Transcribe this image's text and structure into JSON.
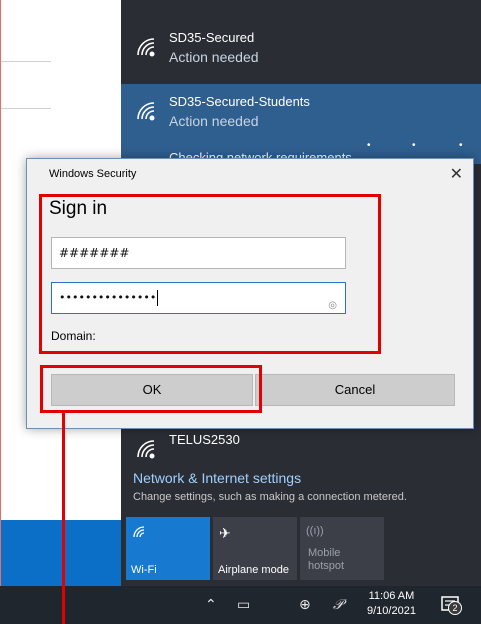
{
  "networks": [
    {
      "name": "SD35-Secured",
      "status": "Action needed"
    },
    {
      "name": "SD35-Secured-Students",
      "status": "Action needed",
      "progress_text": "Checking network requirements"
    },
    {
      "name": "TELUS2530",
      "status": ""
    }
  ],
  "settings": {
    "title": "Network & Internet settings",
    "subtitle": "Change settings, such as making a connection metered."
  },
  "quick_actions": [
    {
      "label": "Wi-Fi",
      "icon": "wifi-icon",
      "active": true
    },
    {
      "label": "Airplane mode",
      "icon": "airplane-icon",
      "active": false
    },
    {
      "label": "Mobile hotspot",
      "line1": "Mobile",
      "line2": "hotspot",
      "icon": "hotspot-icon",
      "active": false,
      "disabled": true
    }
  ],
  "dialog": {
    "title": "Windows Security",
    "heading": "Sign in",
    "username_value": "#######",
    "password_value": "•••••••••••••••",
    "domain_label": "Domain:",
    "ok_label": "OK",
    "cancel_label": "Cancel"
  },
  "taskbar": {
    "time": "11:06 AM",
    "date": "9/10/2021",
    "notification_count": "2"
  },
  "colors": {
    "flyout_bg": "#2b2d35",
    "active_network": "#2f5f8f",
    "accent": "#1879d1",
    "annotation": "#e40000"
  }
}
